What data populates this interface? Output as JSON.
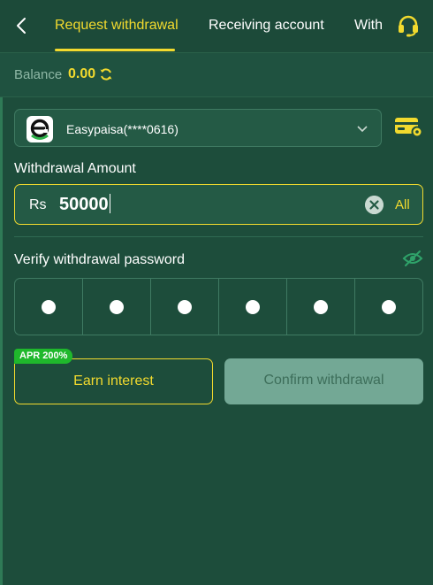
{
  "header": {
    "tabs": [
      {
        "label": "Request withdrawal",
        "active": true
      },
      {
        "label": "Receiving account",
        "active": false
      },
      {
        "label": "Withdrawal history",
        "active": false
      }
    ],
    "icons": {
      "back": "chevron-left-icon",
      "support": "headset-icon"
    }
  },
  "balance": {
    "label": "Balance",
    "value": "0.00",
    "icon": "refresh-icon"
  },
  "account": {
    "name": "Easypaisa(****0616)",
    "logo": "easypaisa-logo",
    "icon": "chevron-down-icon",
    "manage_icon": "card-settings-icon"
  },
  "amount": {
    "label": "Withdrawal Amount",
    "currency": "Rs",
    "value": "50000",
    "all_label": "All"
  },
  "password": {
    "label": "Verify withdrawal password",
    "length": 6,
    "filled": 6
  },
  "actions": {
    "badge": "APR 200%",
    "earn_label": "Earn interest",
    "confirm_label": "Confirm withdrawal"
  },
  "colors": {
    "accent": "#f2da2e",
    "background": "#1d4d3b",
    "badge": "#1fb82c",
    "disabled_button": "#73a895"
  }
}
